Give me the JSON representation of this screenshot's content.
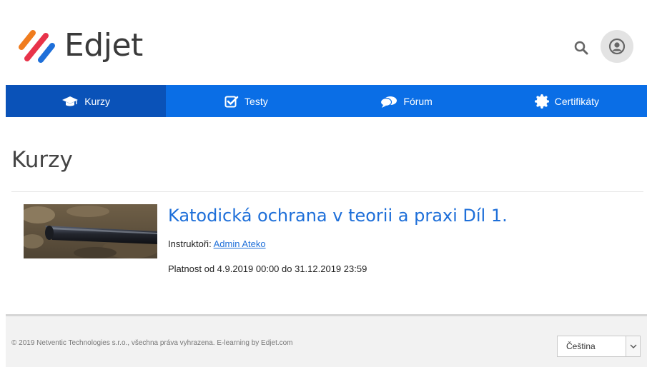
{
  "header": {
    "logo_text": "Edjet",
    "search_icon": "search-icon",
    "avatar_icon": "user-circle-icon"
  },
  "nav": {
    "items": [
      {
        "label": "Kurzy",
        "icon": "graduation-cap-icon",
        "active": true
      },
      {
        "label": "Testy",
        "icon": "checkbox-icon",
        "active": false
      },
      {
        "label": "Fórum",
        "icon": "chat-bubbles-icon",
        "active": false
      },
      {
        "label": "Certifikáty",
        "icon": "certificate-seal-icon",
        "active": false
      }
    ]
  },
  "colors": {
    "nav": "#0a6ee6",
    "nav_active": "#0a52b8",
    "link": "#1e6fd9",
    "logo_orange": "#f07c1e",
    "logo_red": "#e8334a"
  },
  "main": {
    "title": "Kurzy",
    "courses": [
      {
        "title": "Katodická ochrana v teorii a praxi Díl 1.",
        "instructors_label": "Instruktoři:",
        "instructor_name": "Admin Ateko",
        "validity": "Platnost od 4.9.2019 00:00 do 31.12.2019 23:59"
      }
    ]
  },
  "footer": {
    "copyright": "© 2019 Netventic Technologies s.r.o., všechna práva vyhrazena. E-learning by Edjet.com",
    "language": "Čeština"
  }
}
